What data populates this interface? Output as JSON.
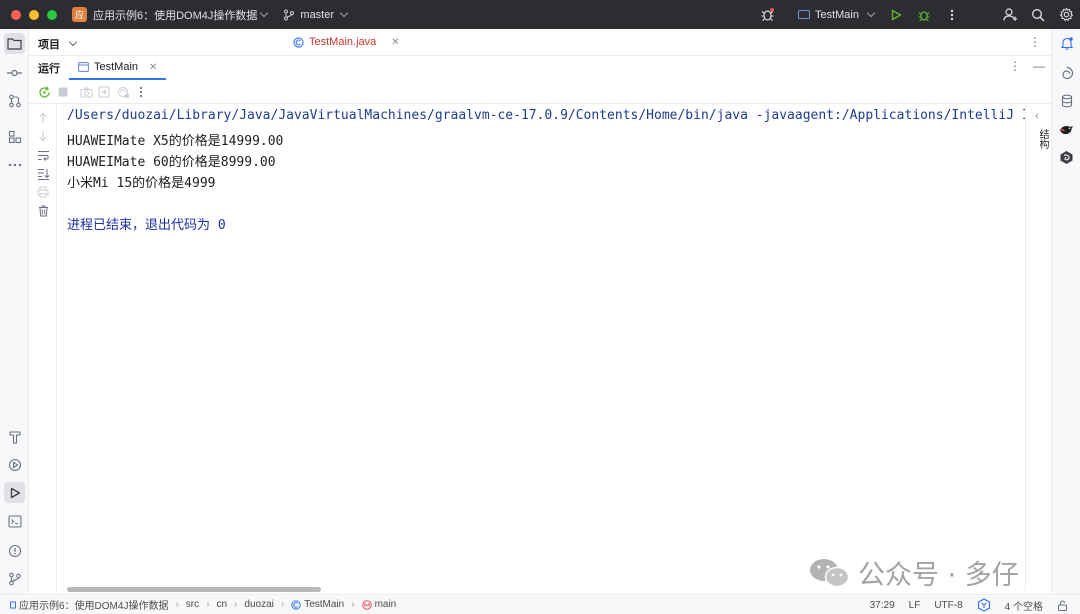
{
  "titlebar": {
    "project_badge": "应",
    "project_name": "应用示例6：使用DOM4J操作数据",
    "branch": "master",
    "run_config": "TestMain"
  },
  "project_panel": {
    "title": "项目"
  },
  "editor": {
    "tabs": [
      {
        "label": "TestMain.java"
      }
    ]
  },
  "run_panel": {
    "title": "运行",
    "tab_label": "TestMain"
  },
  "console": {
    "command": "/Users/duozai/Library/Java/JavaVirtualMachines/graalvm-ce-17.0.9/Contents/Home/bin/java -javaagent:/Applications/IntelliJ IDEA.app/Contents/lib/idea_rt.jar",
    "lines": [
      {
        "product": "HUAWEIMate X5",
        "label": "的价格是",
        "price": "14999.00"
      },
      {
        "product": "HUAWEIMate 60",
        "label": "的价格是",
        "price": "8999.00"
      },
      {
        "product_cn": "小米",
        "product": "Mi 15",
        "label": "的价格是",
        "price": "4999"
      }
    ],
    "exit_text": "进程已结束，退出代码为",
    "exit_code": "0"
  },
  "side_panel": {
    "structure_label": "结构"
  },
  "watermark": {
    "text": "公众号 · 多仔"
  },
  "statusbar": {
    "breadcrumbs": [
      "应用示例6：使用DOM4J操作数据",
      "src",
      "cn",
      "duozai",
      "TestMain",
      "main"
    ],
    "cursor": "37:29",
    "line_sep": "LF",
    "encoding": "UTF-8",
    "indent": "4 个空格"
  },
  "colors": {
    "accent": "#3574f0",
    "titlebar_bg": "#2b2d30",
    "error_tab": "#c4372f",
    "run_green": "#5fb832"
  }
}
